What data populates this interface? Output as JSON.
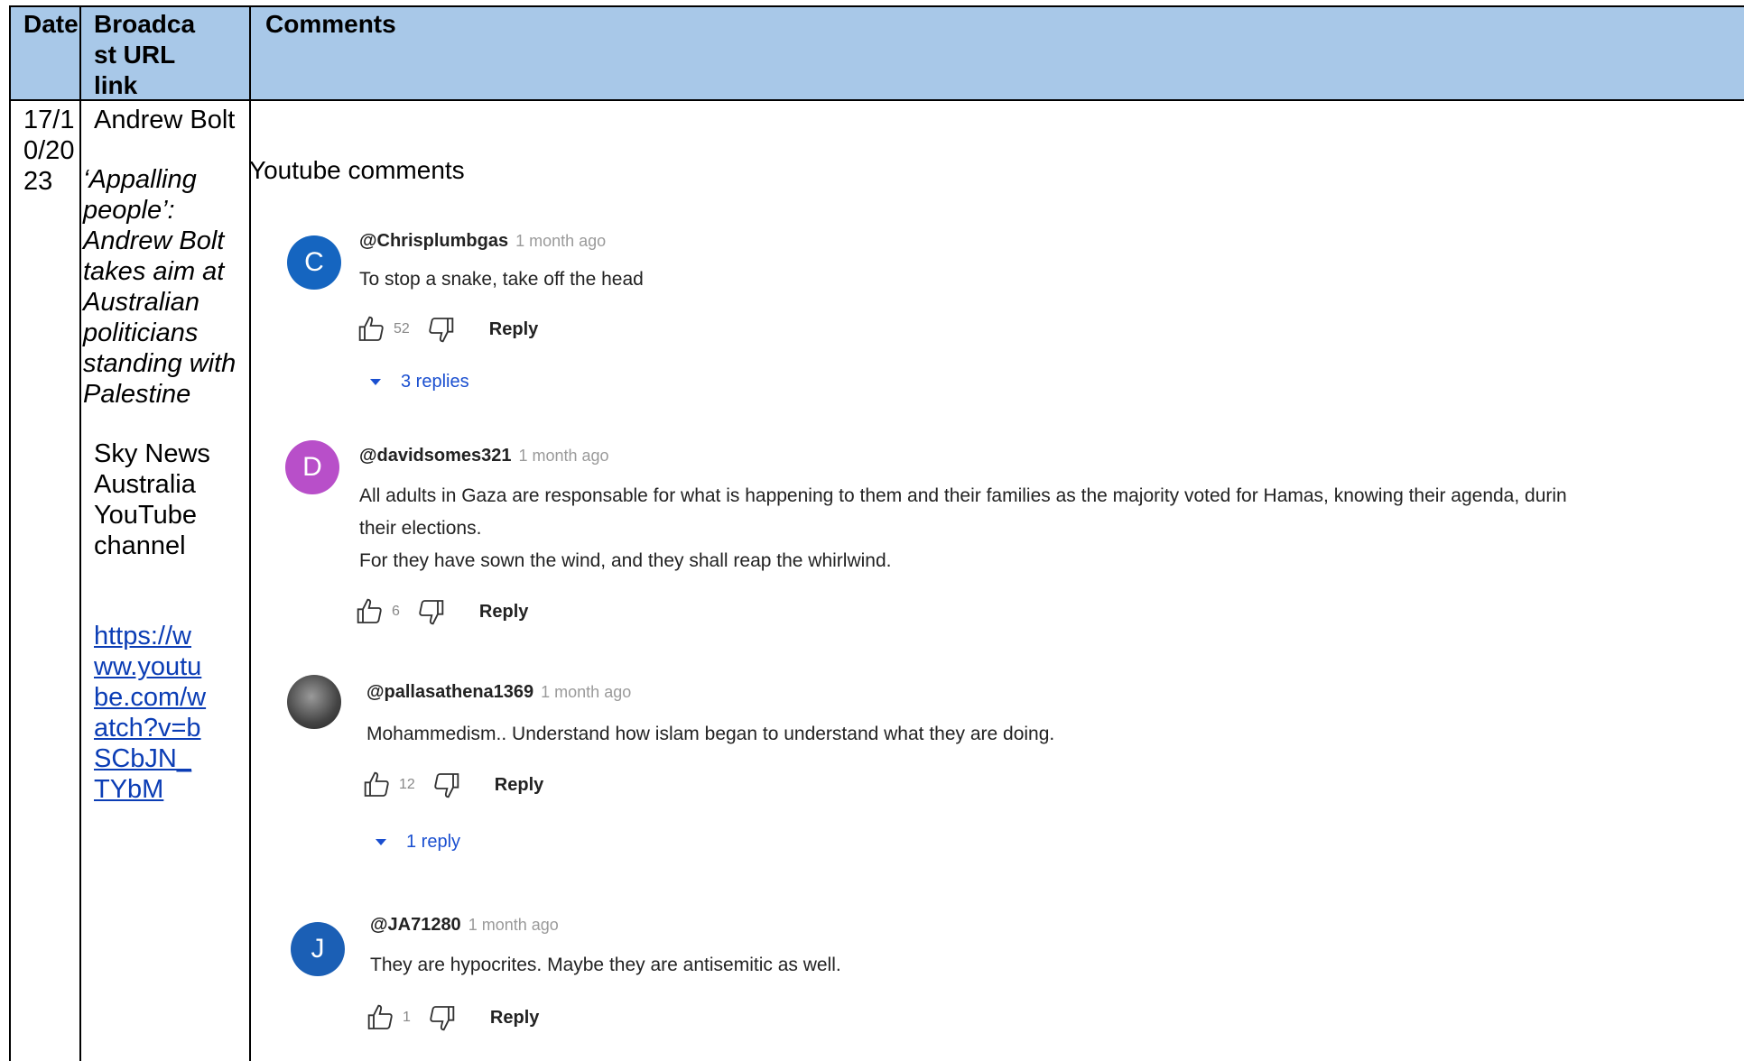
{
  "header": {
    "col_date": "Date",
    "col_broadcast": "Broadca\nst URL\nlink",
    "col_comments": "Comments"
  },
  "row": {
    "date": "17/1\n0/20\n23",
    "presenter": "Andrew Bolt",
    "episode_title": "‘Appalling people’: Andrew Bolt takes aim at Australian politicians standing with Palestine",
    "channel": "Sky News Australia YouTube channel",
    "url_text": "https://w\nww.youtu\nbe.com/w\natch?v=b\nSCbJN_\nTYbM"
  },
  "comments_section": {
    "heading": "Youtube comments",
    "reply_label": "Reply",
    "items": [
      {
        "avatar_letter": "C",
        "avatar_color": "#1565c0",
        "handle": "@Chrisplumbgas",
        "time": "1 month ago",
        "lines": [
          "To stop a snake, take off the head"
        ],
        "likes": "52",
        "replies": "3 replies"
      },
      {
        "avatar_letter": "D",
        "avatar_color": "#b84fc9",
        "handle": "@davidsomes321",
        "time": "1 month ago",
        "lines": [
          "All adults in Gaza are responsable for what is happening to them and their families as the majority voted for Hamas, knowing their agenda, durin",
          "their elections.",
          "For they have sown the wind, and they shall reap the whirlwind."
        ],
        "likes": "6",
        "replies": ""
      },
      {
        "avatar_letter": "",
        "avatar_color": "#555555",
        "handle": "@pallasathena1369",
        "time": "1 month ago",
        "lines": [
          "Mohammedism.. Understand how islam began to understand what they are doing."
        ],
        "likes": "12",
        "replies": "1 reply"
      },
      {
        "avatar_letter": "J",
        "avatar_color": "#1b5fb5",
        "handle": "@JA71280",
        "time": "1 month ago",
        "lines": [
          "They are hypocrites. Maybe they are antisemitic as well."
        ],
        "likes": "1",
        "replies": ""
      }
    ]
  }
}
